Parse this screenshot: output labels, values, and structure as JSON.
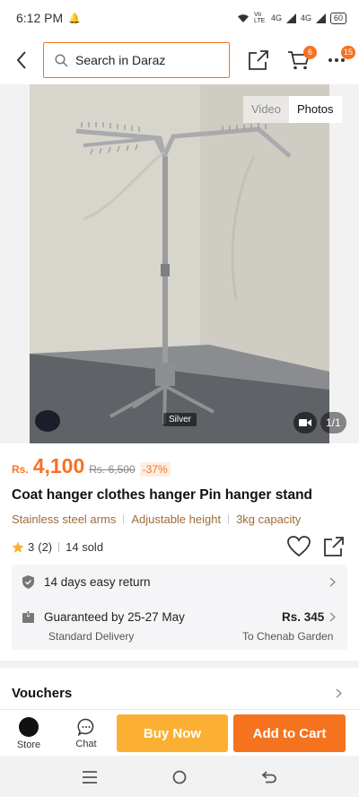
{
  "status_bar": {
    "time": "6:12 PM",
    "network": "Vo LTE",
    "signal1": "4G",
    "signal2": "4G",
    "battery": "60"
  },
  "header": {
    "search_placeholder": "Search in Daraz",
    "cart_count": "6",
    "more_count": "15"
  },
  "media": {
    "tabs": [
      {
        "label": "Video",
        "active": false
      },
      {
        "label": "Photos",
        "active": true
      }
    ],
    "variant_label": "Silver",
    "page_counter": "1/1"
  },
  "product": {
    "currency": "Rs.",
    "price": "4,100",
    "old_price": "Rs. 6,500",
    "discount": "-37%",
    "title": "Coat hanger clothes hanger Pin hanger stand",
    "features": [
      "Stainless steel arms",
      "Adjustable height",
      "3kg capacity"
    ],
    "rating": "3",
    "rating_count": "(2)",
    "sold": "14 sold"
  },
  "services": {
    "return_label": "14 days easy return",
    "delivery_label": "Guaranteed by 25-27 May",
    "delivery_type": "Standard Delivery",
    "delivery_price": "Rs. 345",
    "delivery_location": "To Chenab Garden"
  },
  "vouchers": {
    "title": "Vouchers"
  },
  "bottom_bar": {
    "store_label": "Store",
    "chat_label": "Chat",
    "buy_now": "Buy Now",
    "add_to_cart": "Add to Cart"
  },
  "colors": {
    "accent": "#f57224",
    "buy_now": "#fbb033",
    "add_to_cart": "#f5731f",
    "feature_text": "#9e6b3b"
  },
  "icons": [
    "back-arrow-icon",
    "search-icon",
    "share-icon",
    "cart-icon",
    "more-icon",
    "video-icon",
    "star-icon",
    "heart-icon",
    "shield-icon",
    "delivery-icon",
    "chevron-right-icon",
    "chat-icon",
    "menu-icon",
    "home-icon",
    "back-icon"
  ]
}
